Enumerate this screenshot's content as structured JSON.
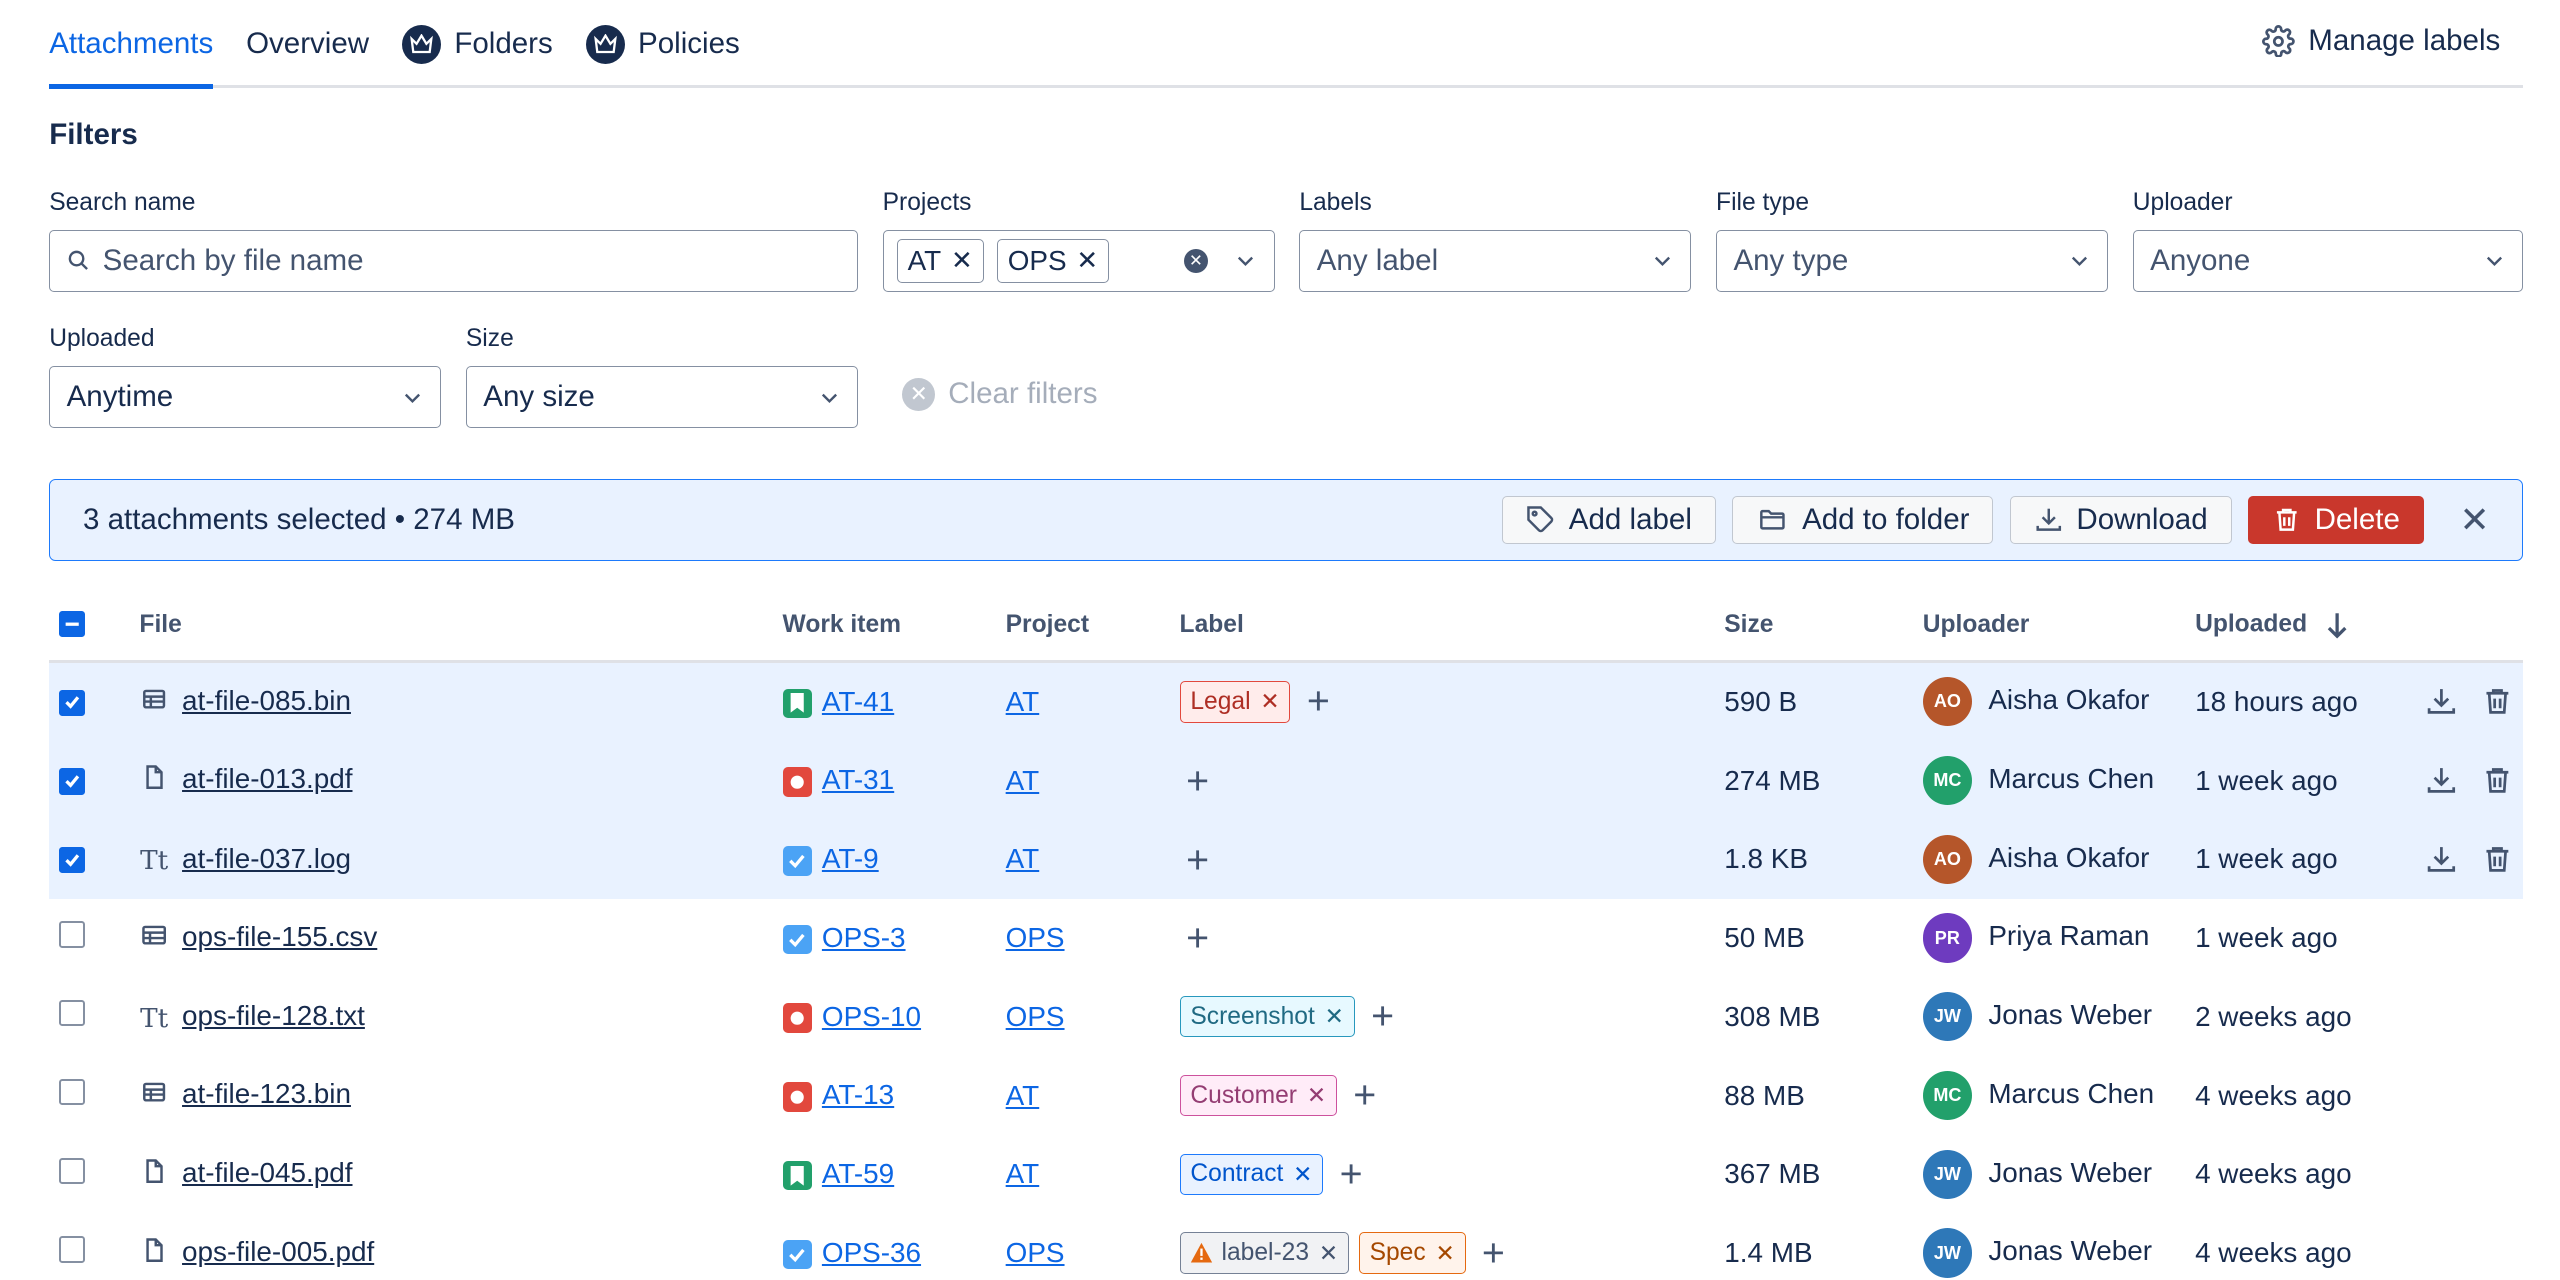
{
  "tabs": [
    {
      "label": "Attachments",
      "active": true,
      "crown": false
    },
    {
      "label": "Overview",
      "active": false,
      "crown": false
    },
    {
      "label": "Folders",
      "active": false,
      "crown": true
    },
    {
      "label": "Policies",
      "active": false,
      "crown": true
    }
  ],
  "manage_labels": "Manage labels",
  "filters": {
    "heading": "Filters",
    "search": {
      "label": "Search name",
      "placeholder": "Search by file name"
    },
    "projects": {
      "label": "Projects",
      "chips": [
        "AT",
        "OPS"
      ]
    },
    "labels": {
      "label": "Labels",
      "value": "Any label"
    },
    "file_type": {
      "label": "File type",
      "value": "Any type"
    },
    "uploader": {
      "label": "Uploader",
      "value": "Anyone"
    },
    "uploaded": {
      "label": "Uploaded",
      "value": "Anytime"
    },
    "size": {
      "label": "Size",
      "value": "Any size"
    },
    "clear": "Clear filters"
  },
  "selection": {
    "text": "3 attachments selected • 274 MB",
    "add_label": "Add label",
    "add_folder": "Add to folder",
    "download": "Download",
    "delete": "Delete"
  },
  "columns": {
    "file": "File",
    "work_item": "Work item",
    "project": "Project",
    "label": "Label",
    "size": "Size",
    "uploader": "Uploader",
    "uploaded": "Uploaded"
  },
  "colors": {
    "accent": "#0c66e4",
    "danger": "#c9372c",
    "selection_bg": "#e9f2ff"
  },
  "rows": [
    {
      "selected": true,
      "icon": "binary-icon",
      "file": "at-file-085.bin",
      "wi_type": "story",
      "work_item": "AT-41",
      "project": "AT",
      "labels": [
        {
          "text": "Legal",
          "style": "red"
        }
      ],
      "size": "590 B",
      "initials": "AO",
      "avatar": "#b5562a",
      "uploader": "Aisha Okafor",
      "uploaded": "18 hours ago"
    },
    {
      "selected": true,
      "icon": "document-icon",
      "file": "at-file-013.pdf",
      "wi_type": "bug",
      "work_item": "AT-31",
      "project": "AT",
      "labels": [],
      "size": "274 MB",
      "initials": "MC",
      "avatar": "#22a06b",
      "uploader": "Marcus Chen",
      "uploaded": "1 week ago"
    },
    {
      "selected": true,
      "icon": "text-icon",
      "file": "at-file-037.log",
      "wi_type": "task",
      "work_item": "AT-9",
      "project": "AT",
      "labels": [],
      "size": "1.8 KB",
      "initials": "AO",
      "avatar": "#b5562a",
      "uploader": "Aisha Okafor",
      "uploaded": "1 week ago"
    },
    {
      "selected": false,
      "icon": "table-icon",
      "file": "ops-file-155.csv",
      "wi_type": "task",
      "work_item": "OPS-3",
      "project": "OPS",
      "labels": [],
      "size": "50 MB",
      "initials": "PR",
      "avatar": "#6e3bbf",
      "uploader": "Priya Raman",
      "uploaded": "1 week ago"
    },
    {
      "selected": false,
      "icon": "text-icon",
      "file": "ops-file-128.txt",
      "wi_type": "bug",
      "work_item": "OPS-10",
      "project": "OPS",
      "labels": [
        {
          "text": "Screenshot",
          "style": "teal"
        }
      ],
      "size": "308 MB",
      "initials": "JW",
      "avatar": "#2e78b8",
      "uploader": "Jonas Weber",
      "uploaded": "2 weeks ago"
    },
    {
      "selected": false,
      "icon": "binary-icon",
      "file": "at-file-123.bin",
      "wi_type": "bug",
      "work_item": "AT-13",
      "project": "AT",
      "labels": [
        {
          "text": "Customer",
          "style": "magenta"
        }
      ],
      "size": "88 MB",
      "initials": "MC",
      "avatar": "#22a06b",
      "uploader": "Marcus Chen",
      "uploaded": "4 weeks ago"
    },
    {
      "selected": false,
      "icon": "document-icon",
      "file": "at-file-045.pdf",
      "wi_type": "story",
      "work_item": "AT-59",
      "project": "AT",
      "labels": [
        {
          "text": "Contract",
          "style": "blue"
        }
      ],
      "size": "367 MB",
      "initials": "JW",
      "avatar": "#2e78b8",
      "uploader": "Jonas Weber",
      "uploaded": "4 weeks ago"
    },
    {
      "selected": false,
      "icon": "document-icon",
      "file": "ops-file-005.pdf",
      "wi_type": "task",
      "work_item": "OPS-36",
      "project": "OPS",
      "labels": [
        {
          "text": "label-23",
          "style": "gray",
          "warn": true
        },
        {
          "text": "Spec",
          "style": "orange"
        }
      ],
      "size": "1.4 MB",
      "initials": "JW",
      "avatar": "#2e78b8",
      "uploader": "Jonas Weber",
      "uploaded": "4 weeks ago"
    }
  ]
}
